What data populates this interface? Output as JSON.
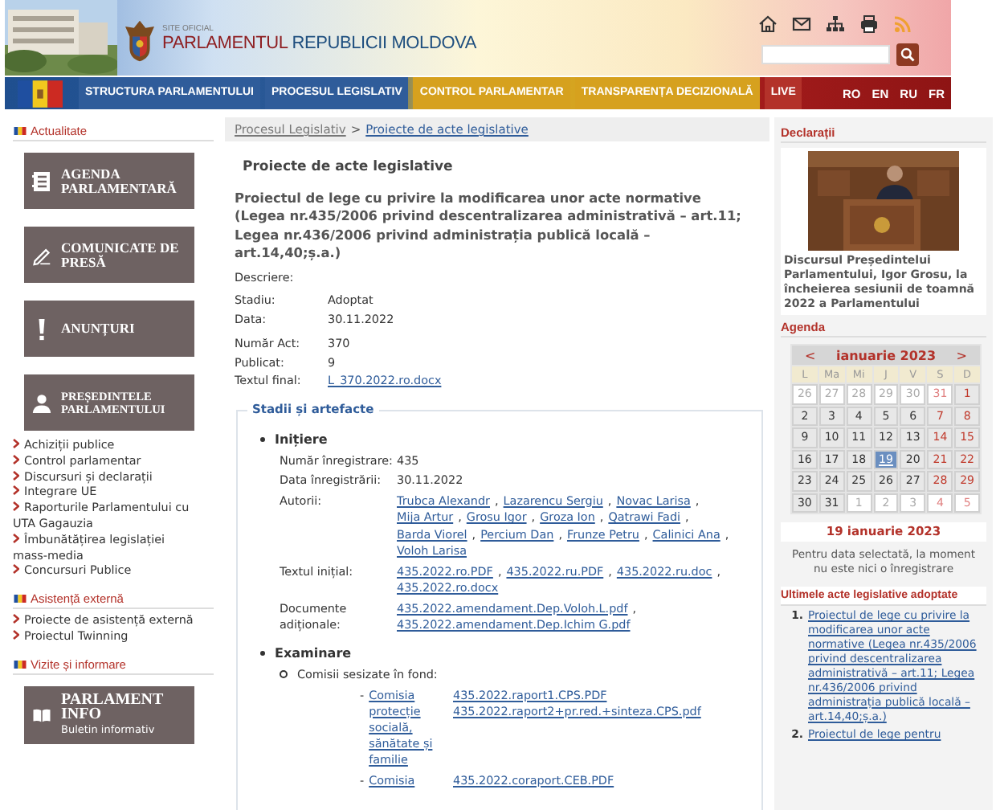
{
  "header": {
    "site_label": "SITE OFICIAL",
    "title_part1": "PARLAMENTUL",
    "title_part2": "REPUBLICII MOLDOVA"
  },
  "nav": {
    "items": [
      {
        "label": "STRUCTURA PARLAMENTULUI",
        "color": "#2f5c9a"
      },
      {
        "label": "PROCESUL LEGISLATIV",
        "color": "#2f5c9a"
      },
      {
        "label": "CONTROL PARLAMENTAR",
        "color": "#d6a11e"
      },
      {
        "label": "TRANSPARENȚA DECIZIONALĂ",
        "color": "#d6a11e"
      },
      {
        "label": "LIVE",
        "color": "#b3322a"
      }
    ],
    "languages": [
      "RO",
      "EN",
      "RU",
      "FR"
    ]
  },
  "left": {
    "news_heading": "Actualitate",
    "tiles": [
      {
        "label": "AGENDA PARLAMENTARĂ"
      },
      {
        "label": "COMUNICATE DE PRESĂ"
      },
      {
        "label": "ANUNȚURI"
      },
      {
        "label": "PREȘEDINTELE PARLAMENTULUI"
      }
    ],
    "links": [
      "Achiziții publice",
      "Control parlamentar",
      "Discursuri și declarații",
      "Integrare UE",
      "Raporturile Parlamentului cu UTA Gagauzia",
      "Îmbunătățirea legislației mass-media",
      "Concursuri Publice"
    ],
    "aid_heading": "Asistență externă",
    "aid_links": [
      "Proiecte de asistență externă",
      "Proiectul Twinning"
    ],
    "visits_heading": "Vizite și informare",
    "info_tile": {
      "label": "PARLAMENT INFO",
      "sub": "Buletin informativ"
    }
  },
  "breadcrumb": [
    {
      "label": "Procesul Legislativ"
    },
    {
      "label": ">"
    },
    {
      "label": "Proiecte de acte legislative"
    }
  ],
  "page_title": "Proiecte de acte legislative",
  "project_title": "Proiectul de lege cu privire la modificarea unor acte normative (Legea nr.435/2006 privind descentralizarea administrativă – art.11; Legea nr.436/2006 privind administrația publică locală – art.14,40;ș.a.)",
  "description_label": "Descriere:",
  "details": [
    [
      {
        "label": "Stadiu:",
        "value": "Adoptat"
      },
      {
        "label": "Data:",
        "value": "30.11.2022"
      }
    ],
    [
      {
        "label": "Număr Act:",
        "value": "370"
      },
      {
        "label": "Publicat:",
        "value": "9"
      },
      {
        "label": "Textul final:",
        "link": "L_370.2022.ro.docx"
      }
    ]
  ],
  "stages": {
    "legend": "Stadii și artefacte",
    "initiation": {
      "title": "Inițiere",
      "rows": [
        {
          "label": "Număr înregistrare:",
          "value": "435"
        },
        {
          "label": "Data înregistrării:",
          "value": "30.11.2022"
        },
        {
          "label": "Autorii:",
          "separator": ",",
          "links": [
            "Trubca Alexandr",
            "Lazarencu Sergiu",
            "Novac Larisa",
            "Mija Artur",
            "Grosu Igor",
            "Groza Ion",
            "Qatrawi Fadi",
            "Barda Viorel",
            "Percium Dan",
            "Frunze Petru",
            "Calinici Ana",
            "Voloh Larisa"
          ]
        },
        {
          "label": "Textul inițial:",
          "separator": ",",
          "links": [
            "435.2022.ro.PDF",
            "435.2022.ru.PDF",
            "435.2022.ru.doc",
            "435.2022.ro.docx"
          ]
        },
        {
          "label": "Documente adiționale:",
          "separator": ",",
          "links": [
            "435.2022.amendament.Dep.Voloh.L.pdf",
            "435.2022.amendament.Dep.Ichim G.pdf"
          ]
        }
      ]
    },
    "examination": {
      "title": "Examinare",
      "subtitle": "Comisii sesizate în fond:",
      "committees": [
        {
          "marker": "-",
          "name": "Comisia protecție socială, sănătate și familie",
          "links": [
            "435.2022.raport1.CPS.PDF",
            "435.2022.raport2+pr.red.+sinteza.CPS.pdf"
          ]
        },
        {
          "marker": "-",
          "name": "Comisia",
          "links": [
            "435.2022.coraport.CEB.PDF"
          ]
        }
      ]
    }
  },
  "right": {
    "statements_heading": "Declarații",
    "statement_caption": "Discursul Președintelui Parlamentului, Igor Grosu, la încheierea sesiunii de toamnă 2022 a Parlamentului",
    "agenda_heading": "Agenda",
    "calendar": {
      "prev": "<",
      "month": "ianuarie 2023",
      "next": ">",
      "weekdays": [
        "L",
        "Ma",
        "Mi",
        "J",
        "V",
        "S",
        "D"
      ],
      "weeks": [
        [
          {
            "day": "26",
            "other_month": true,
            "selected": false
          },
          {
            "day": "27",
            "other_month": true,
            "selected": false
          },
          {
            "day": "28",
            "other_month": true,
            "selected": false
          },
          {
            "day": "29",
            "other_month": true,
            "selected": false
          },
          {
            "day": "30",
            "other_month": true,
            "selected": false
          },
          {
            "day": "31",
            "other_month": true,
            "selected": false
          },
          {
            "day": "1",
            "other_month": false,
            "selected": false
          }
        ],
        [
          {
            "day": "2",
            "other_month": false,
            "selected": false
          },
          {
            "day": "3",
            "other_month": false,
            "selected": false
          },
          {
            "day": "4",
            "other_month": false,
            "selected": false
          },
          {
            "day": "5",
            "other_month": false,
            "selected": false
          },
          {
            "day": "6",
            "other_month": false,
            "selected": false
          },
          {
            "day": "7",
            "other_month": false,
            "selected": false
          },
          {
            "day": "8",
            "other_month": false,
            "selected": false
          }
        ],
        [
          {
            "day": "9",
            "other_month": false,
            "selected": false
          },
          {
            "day": "10",
            "other_month": false,
            "selected": false
          },
          {
            "day": "11",
            "other_month": false,
            "selected": false
          },
          {
            "day": "12",
            "other_month": false,
            "selected": false
          },
          {
            "day": "13",
            "other_month": false,
            "selected": false
          },
          {
            "day": "14",
            "other_month": false,
            "selected": false
          },
          {
            "day": "15",
            "other_month": false,
            "selected": false
          }
        ],
        [
          {
            "day": "16",
            "other_month": false,
            "selected": false
          },
          {
            "day": "17",
            "other_month": false,
            "selected": false
          },
          {
            "day": "18",
            "other_month": false,
            "selected": false
          },
          {
            "day": "19",
            "other_month": false,
            "selected": true
          },
          {
            "day": "20",
            "other_month": false,
            "selected": false
          },
          {
            "day": "21",
            "other_month": false,
            "selected": false
          },
          {
            "day": "22",
            "other_month": false,
            "selected": false
          }
        ],
        [
          {
            "day": "23",
            "other_month": false,
            "selected": false
          },
          {
            "day": "24",
            "other_month": false,
            "selected": false
          },
          {
            "day": "25",
            "other_month": false,
            "selected": false
          },
          {
            "day": "26",
            "other_month": false,
            "selected": false
          },
          {
            "day": "27",
            "other_month": false,
            "selected": false
          },
          {
            "day": "28",
            "other_month": false,
            "selected": false
          },
          {
            "day": "29",
            "other_month": false,
            "selected": false
          }
        ],
        [
          {
            "day": "30",
            "other_month": false,
            "selected": false
          },
          {
            "day": "31",
            "other_month": false,
            "selected": false
          },
          {
            "day": "1",
            "other_month": true,
            "selected": false
          },
          {
            "day": "2",
            "other_month": true,
            "selected": false
          },
          {
            "day": "3",
            "other_month": true,
            "selected": false
          },
          {
            "day": "4",
            "other_month": true,
            "selected": false
          },
          {
            "day": "5",
            "other_month": true,
            "selected": false
          }
        ]
      ]
    },
    "selected_date": "19 ianuarie 2023",
    "no_entries": "Pentru data selectată, la moment nu este nici o înregistrare",
    "latest_heading": "Ultimele acte legislative adoptate",
    "latest": [
      {
        "number": "1.",
        "title": "Proiectul de lege cu privire la modificarea unor acte normative (Legea nr.435/2006 privind descentralizarea administrativă – art.11; Legea nr.436/2006 privind administrația publică locală – art.14,40;ș.a.)"
      },
      {
        "number": "2.",
        "title": "Proiectul de lege pentru"
      }
    ]
  }
}
